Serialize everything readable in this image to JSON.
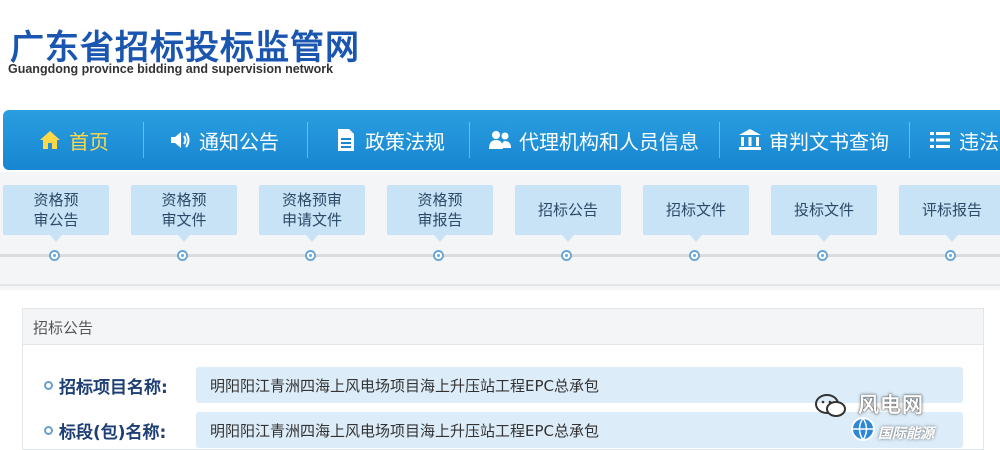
{
  "header": {
    "title": "广东省招标投标监管网",
    "subtitle": "Guangdong province bidding and supervision network"
  },
  "nav": {
    "items": [
      {
        "label": "首页",
        "icon": "home-icon",
        "active": true
      },
      {
        "label": "通知公告",
        "icon": "speaker-icon"
      },
      {
        "label": "政策法规",
        "icon": "document-icon"
      },
      {
        "label": "代理机构和人员信息",
        "icon": "users-icon"
      },
      {
        "label": "审判文书查询",
        "icon": "courthouse-icon"
      },
      {
        "label": "违法",
        "icon": "list-icon"
      }
    ]
  },
  "steps": [
    "资格预\n审公告",
    "资格预\n审文件",
    "资格预审\n申请文件",
    "资格预\n审报告",
    "招标公告",
    "招标文件",
    "投标文件",
    "评标报告"
  ],
  "panel": {
    "title": "招标公告",
    "rows": [
      {
        "label": "招标项目名称:",
        "value": "明阳阳江青洲四海上风电场项目海上升压站工程EPC总承包"
      },
      {
        "label": "标段(包)名称:",
        "value": "明阳阳江青洲四海上风电场项目海上升压站工程EPC总承包"
      }
    ]
  },
  "watermark": {
    "text": "风电网",
    "subtext": "国际能源"
  },
  "colors": {
    "nav_bg": "#1786d1",
    "nav_active": "#ffd84a",
    "title_blue": "#1a56b0",
    "step_bg": "#c8e3f5",
    "value_bg": "#dcecf8",
    "label_blue": "#1e3f73"
  }
}
